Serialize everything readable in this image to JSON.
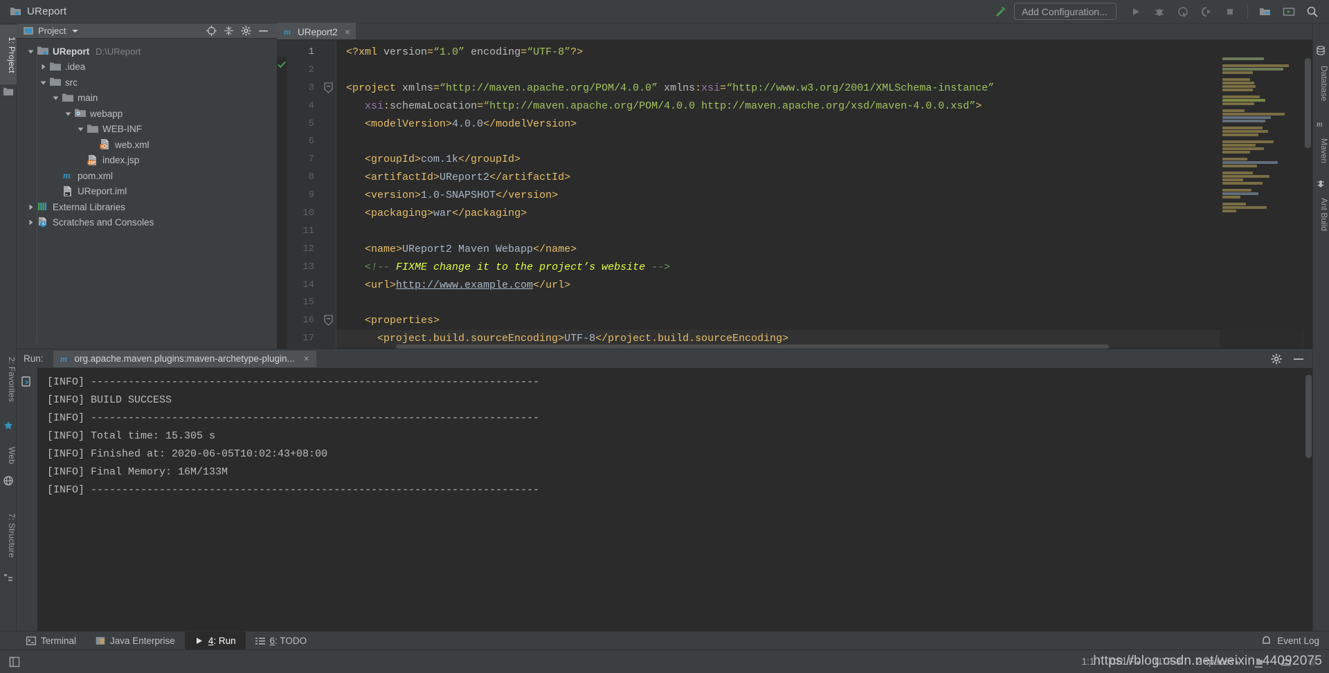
{
  "window": {
    "title": "UReport",
    "add_configuration": "Add Configuration...",
    "toolbar_icons": [
      "hammer-icon",
      "run-icon",
      "debug-icon",
      "run-coverage-icon",
      "run-profiler-icon",
      "stop-icon",
      "project-structure-icon",
      "open-terminal-icon",
      "search-everywhere-icon"
    ]
  },
  "left_tabs": [
    {
      "label": "1: Project",
      "icon": "project-icon",
      "selected": true
    },
    {
      "label": "2: Favorites",
      "icon": "star-icon",
      "selected": false
    },
    {
      "label": "Web",
      "icon": "web-icon",
      "selected": false
    },
    {
      "label": "7: Structure",
      "icon": "structure-icon",
      "selected": false
    }
  ],
  "right_tabs": [
    {
      "label": "Database",
      "icon": "database-icon"
    },
    {
      "label": "Maven",
      "icon": "maven-icon"
    },
    {
      "label": "Ant Build",
      "icon": "ant-icon"
    }
  ],
  "project_panel": {
    "header_title": "Project",
    "header_icons": [
      "locate-icon",
      "collapse-all-icon",
      "settings-icon",
      "hide-icon"
    ],
    "tree": [
      {
        "label": "UReport",
        "path": "D:\\UReport",
        "icon": "module-folder-icon",
        "arrow": "expanded",
        "indent": 0,
        "bold": true
      },
      {
        "label": ".idea",
        "path": "",
        "icon": "folder-icon",
        "arrow": "collapsed",
        "indent": 1,
        "bold": false
      },
      {
        "label": "src",
        "path": "",
        "icon": "folder-icon",
        "arrow": "expanded",
        "indent": 1,
        "bold": false
      },
      {
        "label": "main",
        "path": "",
        "icon": "folder-icon",
        "arrow": "expanded",
        "indent": 2,
        "bold": false
      },
      {
        "label": "webapp",
        "path": "",
        "icon": "source-folder-icon",
        "arrow": "expanded",
        "indent": 3,
        "bold": false
      },
      {
        "label": "WEB-INF",
        "path": "",
        "icon": "folder-icon",
        "arrow": "expanded",
        "indent": 4,
        "bold": false
      },
      {
        "label": "web.xml",
        "path": "",
        "icon": "xml-descriptor-icon",
        "arrow": "none",
        "indent": 5,
        "bold": false
      },
      {
        "label": "index.jsp",
        "path": "",
        "icon": "jsp-file-icon",
        "arrow": "none",
        "indent": 4,
        "bold": false
      },
      {
        "label": "pom.xml",
        "path": "",
        "icon": "maven-file-icon",
        "arrow": "none",
        "indent": 2,
        "bold": false
      },
      {
        "label": "UReport.iml",
        "path": "",
        "icon": "iml-file-icon",
        "arrow": "none",
        "indent": 2,
        "bold": false
      },
      {
        "label": "External Libraries",
        "path": "",
        "icon": "libraries-icon",
        "arrow": "collapsed",
        "indent": 0,
        "bold": false
      },
      {
        "label": "Scratches and Consoles",
        "path": "",
        "icon": "scratches-icon",
        "arrow": "collapsed",
        "indent": 0,
        "bold": false
      }
    ]
  },
  "editor": {
    "tab": {
      "label": "UReport2",
      "icon": "maven-file-icon",
      "close": "×"
    },
    "lines": [
      {
        "n": 1,
        "fold": "none",
        "segments": [
          {
            "t": "<?xml ",
            "c": "tag"
          },
          {
            "t": "version",
            "c": "attr"
          },
          {
            "t": "=",
            "c": "tag"
          },
          {
            "t": "“1.0”",
            "c": "val"
          },
          {
            "t": " ",
            "c": "txt"
          },
          {
            "t": "encoding",
            "c": "attr"
          },
          {
            "t": "=",
            "c": "tag"
          },
          {
            "t": "“UTF-8”",
            "c": "val"
          },
          {
            "t": "?>",
            "c": "tag"
          }
        ]
      },
      {
        "n": 2,
        "fold": "none",
        "segments": []
      },
      {
        "n": 3,
        "fold": "start",
        "segments": [
          {
            "t": "<project ",
            "c": "tag"
          },
          {
            "t": "xmlns",
            "c": "attr"
          },
          {
            "t": "=",
            "c": "tag"
          },
          {
            "t": "“http://maven.apache.org/POM/4.0.0”",
            "c": "val"
          },
          {
            "t": " ",
            "c": "txt"
          },
          {
            "t": "xmlns",
            "c": "attr"
          },
          {
            "t": ":",
            "c": "tag"
          },
          {
            "t": "xsi",
            "c": "ns"
          },
          {
            "t": "=",
            "c": "tag"
          },
          {
            "t": "“http://www.w3.org/2001/XMLSchema-instance”",
            "c": "val"
          }
        ]
      },
      {
        "n": 4,
        "fold": "none",
        "segments": [
          {
            "t": "   ",
            "c": "txt"
          },
          {
            "t": "xsi",
            "c": "ns"
          },
          {
            "t": ":",
            "c": "tag"
          },
          {
            "t": "schemaLocation",
            "c": "attr"
          },
          {
            "t": "=",
            "c": "tag"
          },
          {
            "t": "“http://maven.apache.org/POM/4.0.0 http://maven.apache.org/xsd/maven-4.0.0.xsd”",
            "c": "val"
          },
          {
            "t": ">",
            "c": "tag"
          }
        ]
      },
      {
        "n": 5,
        "fold": "none",
        "segments": [
          {
            "t": "   ",
            "c": "txt"
          },
          {
            "t": "<modelVersion>",
            "c": "tag"
          },
          {
            "t": "4.0.0",
            "c": "txt"
          },
          {
            "t": "</modelVersion>",
            "c": "tag"
          }
        ]
      },
      {
        "n": 6,
        "fold": "none",
        "segments": []
      },
      {
        "n": 7,
        "fold": "none",
        "segments": [
          {
            "t": "   ",
            "c": "txt"
          },
          {
            "t": "<groupId>",
            "c": "tag"
          },
          {
            "t": "com.1k",
            "c": "txt"
          },
          {
            "t": "</groupId>",
            "c": "tag"
          }
        ]
      },
      {
        "n": 8,
        "fold": "none",
        "segments": [
          {
            "t": "   ",
            "c": "txt"
          },
          {
            "t": "<artifactId>",
            "c": "tag"
          },
          {
            "t": "UReport2",
            "c": "txt"
          },
          {
            "t": "</artifactId>",
            "c": "tag"
          }
        ]
      },
      {
        "n": 9,
        "fold": "none",
        "segments": [
          {
            "t": "   ",
            "c": "txt"
          },
          {
            "t": "<version>",
            "c": "tag"
          },
          {
            "t": "1.0-SNAPSHOT",
            "c": "txt"
          },
          {
            "t": "</version>",
            "c": "tag"
          }
        ]
      },
      {
        "n": 10,
        "fold": "none",
        "segments": [
          {
            "t": "   ",
            "c": "txt"
          },
          {
            "t": "<packaging>",
            "c": "tag"
          },
          {
            "t": "war",
            "c": "txt"
          },
          {
            "t": "</packaging>",
            "c": "tag"
          }
        ]
      },
      {
        "n": 11,
        "fold": "none",
        "segments": []
      },
      {
        "n": 12,
        "fold": "none",
        "segments": [
          {
            "t": "   ",
            "c": "txt"
          },
          {
            "t": "<name>",
            "c": "tag"
          },
          {
            "t": "UReport2 Maven Webapp",
            "c": "txt"
          },
          {
            "t": "</name>",
            "c": "tag"
          }
        ]
      },
      {
        "n": 13,
        "fold": "none",
        "segments": [
          {
            "t": "   ",
            "c": "txt"
          },
          {
            "t": "<!-- ",
            "c": "cmt"
          },
          {
            "t": "FIXME change it to the project’s website",
            "c": "fixme"
          },
          {
            "t": " -->",
            "c": "cmt"
          }
        ]
      },
      {
        "n": 14,
        "fold": "none",
        "segments": [
          {
            "t": "   ",
            "c": "txt"
          },
          {
            "t": "<url>",
            "c": "tag"
          },
          {
            "t": "http://www.example.com",
            "c": "link"
          },
          {
            "t": "</url>",
            "c": "tag"
          }
        ]
      },
      {
        "n": 15,
        "fold": "none",
        "segments": []
      },
      {
        "n": 16,
        "fold": "start",
        "segments": [
          {
            "t": "   ",
            "c": "txt"
          },
          {
            "t": "<properties>",
            "c": "tag"
          }
        ]
      },
      {
        "n": 17,
        "fold": "none",
        "segments": [
          {
            "t": "     ",
            "c": "txt"
          },
          {
            "t": "<project.build.sourceEncoding>",
            "c": "tag"
          },
          {
            "t": "UTF-8",
            "c": "txt"
          },
          {
            "t": "</project.build.sourceEncoding>",
            "c": "tag"
          }
        ]
      }
    ]
  },
  "run_panel": {
    "label": "Run:",
    "tab_title": "org.apache.maven.plugins:maven-archetype-plugin...",
    "tab_icon": "maven-file-icon",
    "close": "×",
    "header_icons": [
      "settings-icon",
      "hide-icon"
    ],
    "console_lines": [
      "[INFO] ------------------------------------------------------------------------",
      "[INFO] BUILD SUCCESS",
      "[INFO] ------------------------------------------------------------------------",
      "[INFO] Total time: 15.305 s",
      "[INFO] Finished at: 2020-06-05T10:02:43+08:00",
      "[INFO] Final Memory: 16M/133M",
      "[INFO] ------------------------------------------------------------------------"
    ]
  },
  "bottom_tabs": [
    {
      "label": "Terminal",
      "icon": "terminal-icon",
      "selected": false,
      "mnemonic": ""
    },
    {
      "label": "Java Enterprise",
      "icon": "java-enterprise-icon",
      "selected": false,
      "mnemonic": ""
    },
    {
      "label": ": Run",
      "icon": "run-icon",
      "selected": true,
      "mnemonic": "4"
    },
    {
      "label": ": TODO",
      "icon": "todo-icon",
      "selected": false,
      "mnemonic": "6"
    }
  ],
  "event_log": {
    "label": "Event Log",
    "icon": "event-log-icon"
  },
  "status_bar": {
    "caret": "1:1",
    "line_separator": "CRLF",
    "encoding": "UTF-8",
    "indent": "2 spaces",
    "watermark": "https://blog.csdn.net/weixin_44092075"
  },
  "colors": {
    "bg": "#3c3f41",
    "editor_bg": "#2b2b2b",
    "tag": "#e8bf6a",
    "value": "#a5c261",
    "ns": "#9876aa",
    "comment": "#629755",
    "fixme": "#e2ff3a",
    "text": "#a9b7c6",
    "selected_tab": "#4e5254",
    "accent_green": "#499c54"
  }
}
